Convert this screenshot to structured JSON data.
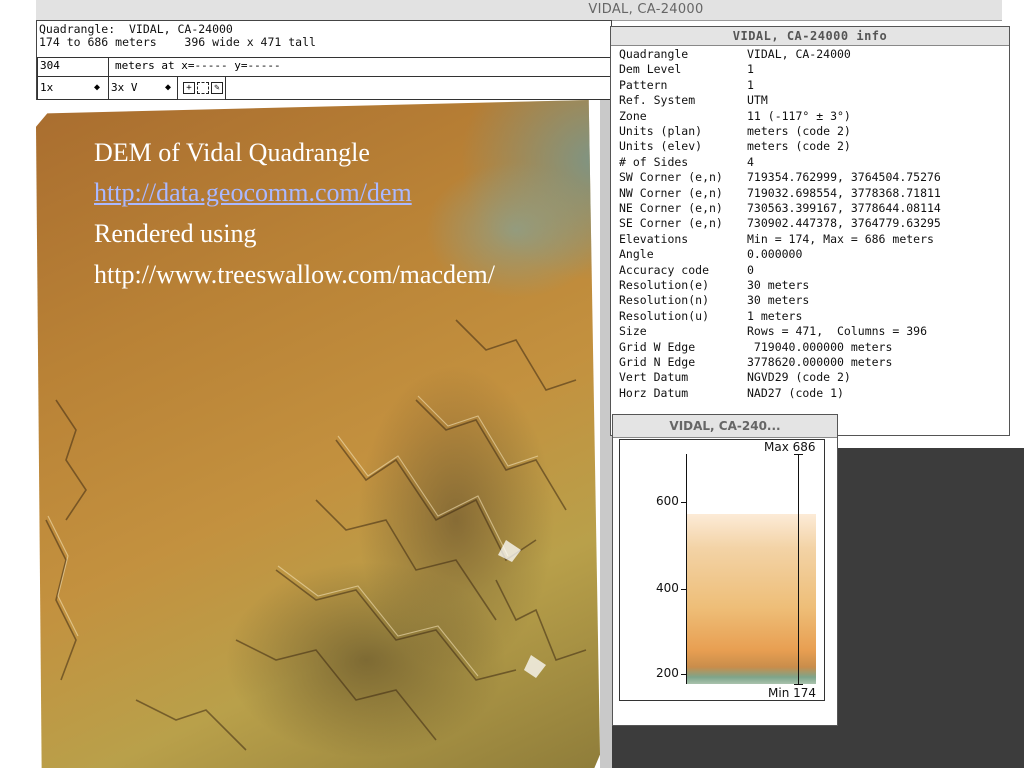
{
  "window": {
    "title": "VIDAL, CA-24000"
  },
  "info_panel": {
    "quadrangle_line": "Quadrangle:  VIDAL, CA-24000",
    "range_line": "174 to 686 meters    396 wide x 471 tall",
    "elev_value": "304",
    "cursor_label": "meters at x=----- y=-----",
    "zoom_select": "1x",
    "vexag_select": "3x V"
  },
  "overlay": {
    "line1": "DEM of Vidal Quadrangle",
    "link": "http://data.geocomm.com/dem",
    "line3": "Rendered using",
    "line4": "http://www.treeswallow.com/macdem/"
  },
  "info_window": {
    "title": "VIDAL, CA-24000 info",
    "rows": [
      {
        "key": "Quadrangle",
        "value": "VIDAL, CA-24000"
      },
      {
        "key": "Dem Level",
        "value": "1"
      },
      {
        "key": "Pattern",
        "value": "1"
      },
      {
        "key": "Ref. System",
        "value": "UTM"
      },
      {
        "key": "Zone",
        "value": "11 (-117° ± 3°)"
      },
      {
        "key": "Units (plan)",
        "value": "meters (code 2)"
      },
      {
        "key": "Units (elev)",
        "value": "meters (code 2)"
      },
      {
        "key": "# of Sides",
        "value": "4"
      },
      {
        "key": "SW Corner (e,n)",
        "value": "719354.762999, 3764504.75276"
      },
      {
        "key": "NW Corner (e,n)",
        "value": "719032.698554, 3778368.71811"
      },
      {
        "key": "NE Corner (e,n)",
        "value": "730563.399167, 3778644.08114"
      },
      {
        "key": "SE Corner (e,n)",
        "value": "730902.447378, 3764779.63295"
      },
      {
        "key": "Elevations",
        "value": "Min = 174, Max = 686 meters"
      },
      {
        "key": "Angle",
        "value": "0.000000"
      },
      {
        "key": "Accuracy code",
        "value": "0"
      },
      {
        "key": "Resolution(e)",
        "value": "30 meters"
      },
      {
        "key": "Resolution(n)",
        "value": "30 meters"
      },
      {
        "key": "Resolution(u)",
        "value": "1 meters"
      },
      {
        "key": "Size",
        "value": "Rows = 471,  Columns = 396"
      },
      {
        "key": "Grid W Edge",
        "value": " 719040.000000 meters"
      },
      {
        "key": "Grid N Edge",
        "value": "3778620.000000 meters"
      },
      {
        "key": "Vert Datum",
        "value": "NGVD29 (code 2)"
      },
      {
        "key": "Horz Datum",
        "value": "NAD27 (code 1)"
      }
    ]
  },
  "legend_window": {
    "title": "VIDAL, CA-240...",
    "max_label": "Max 686",
    "min_label": "Min 174",
    "ticks": [
      "600",
      "400",
      "200"
    ],
    "min_value": 174,
    "max_value": 686
  },
  "colors": {
    "overlay_text": "#ffffff",
    "link": "#aab8ff",
    "dark_background": "#3c3c3c"
  }
}
